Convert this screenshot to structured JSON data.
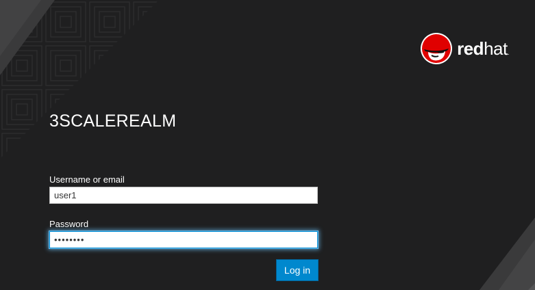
{
  "brand": {
    "logo_icon": "redhat-shadowman-icon",
    "wordmark_bold": "red",
    "wordmark_light": "hat",
    "trademark": "."
  },
  "realm": {
    "title": "3SCALEREALM"
  },
  "form": {
    "username_label": "Username or email",
    "username_value": "user1",
    "password_label": "Password",
    "password_value": "••••••••",
    "submit_label": "Log in"
  },
  "colors": {
    "background": "#1f1f20",
    "accent": "#0088ce",
    "focus_glow": "#66b7e8",
    "logo_red": "#e00000"
  }
}
